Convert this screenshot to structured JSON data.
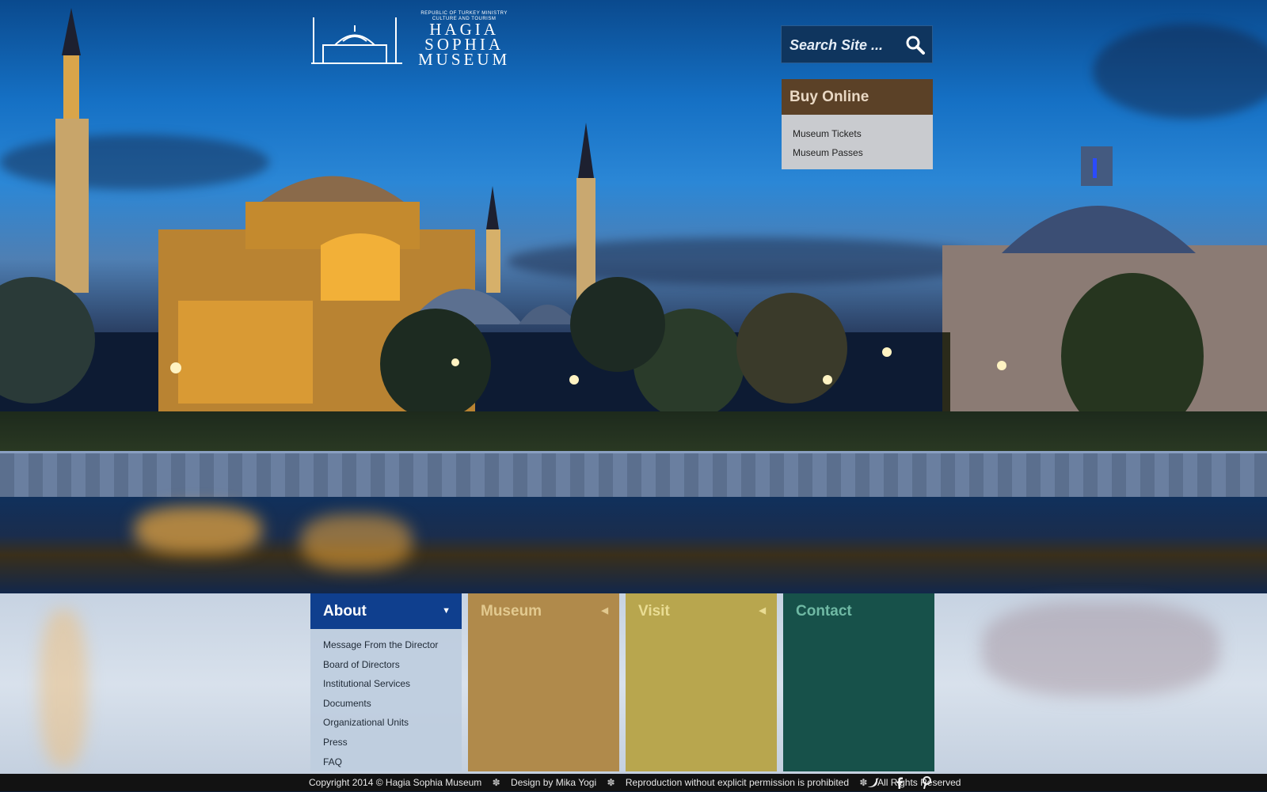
{
  "logo": {
    "ministry_line1": "REPUBLIC OF TURKEY MINISTRY",
    "ministry_line2": "CULTURE AND TOURISM",
    "name_line1": "HAGIA",
    "name_line2": "SOPHIA",
    "name_line3": "MUSEUM"
  },
  "search": {
    "placeholder": "Search Site ..."
  },
  "buy_online": {
    "title": "Buy Online",
    "links": [
      "Museum Tickets",
      "Museum Passes"
    ]
  },
  "menus": {
    "about": {
      "label": "About",
      "items": [
        "Message From the Director",
        "Board of Directors",
        "Institutional Services",
        "Documents",
        "Organizational Units",
        "Press",
        "FAQ"
      ]
    },
    "museum": {
      "label": "Museum"
    },
    "visit": {
      "label": "Visit"
    },
    "contact": {
      "label": "Contact"
    }
  },
  "footer": {
    "copyright": "Copyright 2014 © Hagia Sophia Museum",
    "design": "Design by Mika Yogi",
    "reproduction": "Reproduction without explicit permission is prohibited",
    "rights": "All Rights Reserved"
  },
  "social_icons": [
    "twitter-icon",
    "facebook-icon",
    "pinterest-icon"
  ],
  "colors": {
    "about": "#0f3f8e",
    "museum": "#b08a4b",
    "visit": "#b8a64e",
    "contact": "#17514a",
    "buy_online": "#5b4127"
  }
}
